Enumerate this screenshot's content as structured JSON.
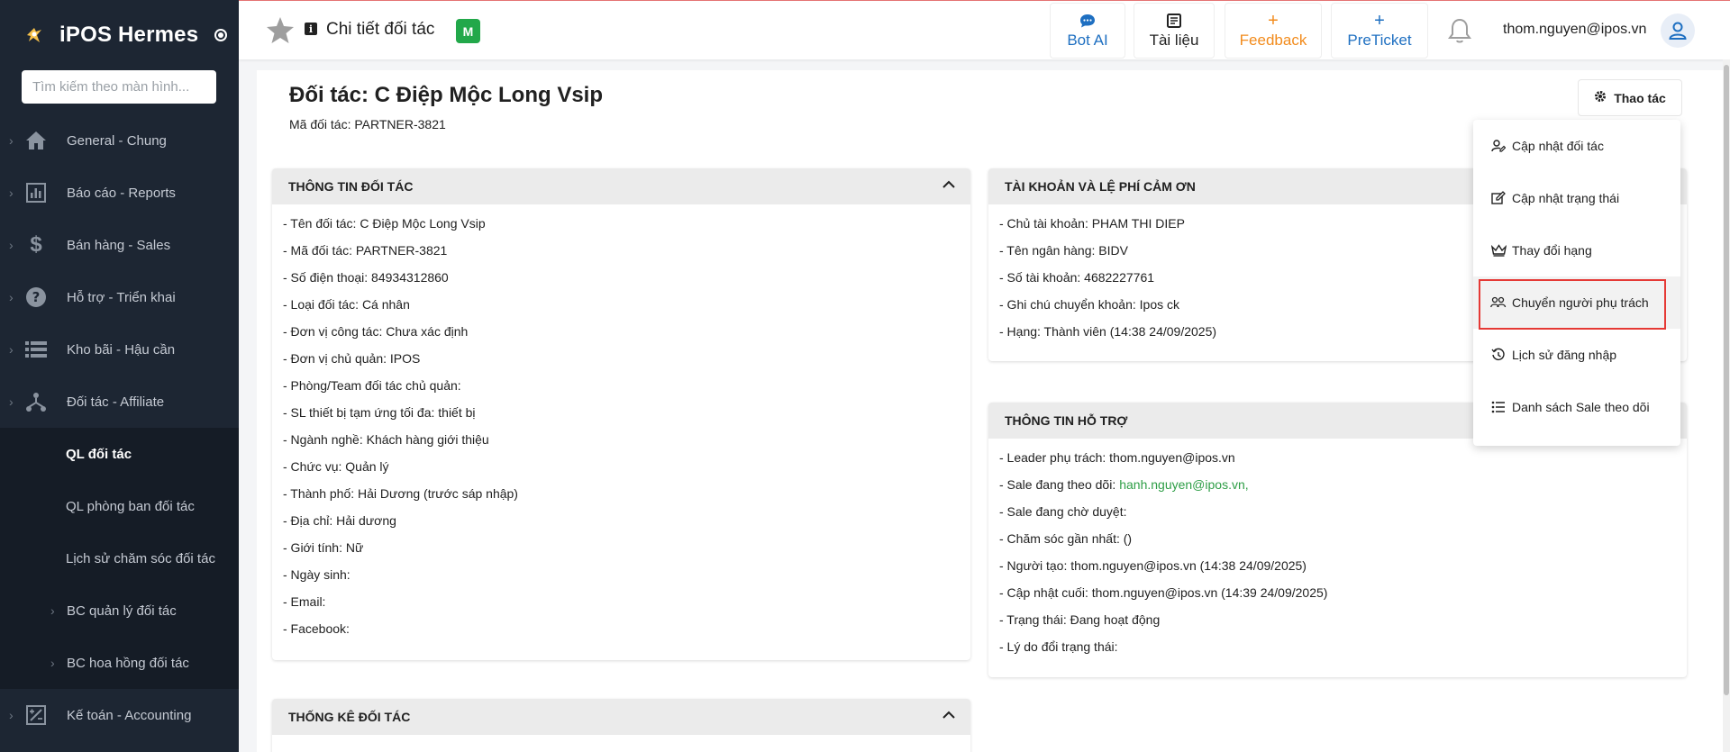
{
  "app": {
    "name": "iPOS Hermes",
    "search_placeholder": "Tìm kiếm theo màn hình..."
  },
  "sidebar": {
    "items": [
      {
        "label": "General - Chung",
        "icon": "home-icon"
      },
      {
        "label": "Báo cáo - Reports",
        "icon": "report-chart-icon"
      },
      {
        "label": "Bán hàng - Sales",
        "icon": "dollar-icon"
      },
      {
        "label": "Hỗ trợ - Triển khai",
        "icon": "help-circle-icon"
      },
      {
        "label": "Kho bãi - Hậu cần",
        "icon": "list-icon"
      },
      {
        "label": "Đối tác - Affiliate",
        "icon": "network-icon"
      }
    ],
    "sub_items": [
      {
        "label": "QL đối tác",
        "active": true
      },
      {
        "label": "QL phòng ban đối tác"
      },
      {
        "label": "Lịch sử chăm sóc đối tác"
      },
      {
        "label": "BC quản lý đối tác"
      },
      {
        "label": "BC hoa hồng đối tác"
      }
    ],
    "after_items": [
      {
        "label": "Kế toán - Accounting",
        "icon": "accounting-icon"
      }
    ]
  },
  "header": {
    "title": "Chi tiết đối tác",
    "badge": "M",
    "buttons": {
      "bot_ai": "Bot AI",
      "docs": "Tài liệu",
      "feedback": "Feedback",
      "preticket": "PreTicket",
      "feedback_icon": "+",
      "preticket_icon": "+"
    },
    "user_email": "thom.nguyen@ipos.vn"
  },
  "page": {
    "title": "Đối tác: C Điệp Mộc Long Vsip",
    "subtitle": "Mã đối tác: PARTNER-3821",
    "action_label": "Thao tác"
  },
  "partner_info": {
    "heading": "THÔNG TIN ĐỐI TÁC",
    "rows": [
      "- Tên đối tác: C Điệp Mộc Long Vsip",
      "- Mã đối tác: PARTNER-3821",
      "- Số điện thoại: 84934312860",
      "- Loại đối tác: Cá nhân",
      "- Đơn vị công tác: Chưa xác định",
      "- Đơn vị chủ quản: IPOS",
      "- Phòng/Team đối tác chủ quản:",
      "- SL thiết bị tạm ứng tối đa: thiết bị",
      "- Ngành nghề: Khách hàng giới thiệu",
      "- Chức vụ: Quản lý",
      "- Thành phố: Hải Dương (trước sáp nhập)",
      "- Địa chỉ: Hải dương",
      "- Giới tính: Nữ",
      "- Ngày sinh:",
      "- Email:",
      "- Facebook:"
    ]
  },
  "account_info": {
    "heading": "TÀI KHOẢN VÀ LỆ PHÍ CẢM ƠN",
    "rows": [
      "- Chủ tài khoản: PHAM THI DIEP",
      "- Tên ngân hàng: BIDV",
      "- Số tài khoản: 4682227761",
      "- Ghi chú chuyển khoản: Ipos ck",
      "- Hạng: Thành viên (14:38 24/09/2025)"
    ]
  },
  "support_info": {
    "heading": "THÔNG TIN HỖ TRỢ",
    "rows": [
      {
        "label": "- Leader phụ trách: thom.nguyen@ipos.vn",
        "link": ""
      },
      {
        "label": "- Sale đang theo dõi:",
        "link": "hanh.nguyen@ipos.vn,"
      },
      {
        "label": "- Sale đang chờ duyệt:",
        "link": ""
      },
      {
        "label": "- Chăm sóc gần nhất: ()",
        "link": ""
      },
      {
        "label": "- Người tạo: thom.nguyen@ipos.vn (14:38 24/09/2025)",
        "link": ""
      },
      {
        "label": "- Cập nhật cuối: thom.nguyen@ipos.vn (14:39 24/09/2025)",
        "link": ""
      },
      {
        "label": "- Trạng thái: Đang hoạt động",
        "link": ""
      },
      {
        "label": "- Lý do đổi trạng thái:",
        "link": ""
      }
    ]
  },
  "stats": {
    "heading": "THỐNG KÊ ĐỐI TÁC"
  },
  "action_menu": {
    "items": [
      {
        "label": "Cập nhật đối tác",
        "icon": "user-edit-icon"
      },
      {
        "label": "Cập nhật trạng thái",
        "icon": "edit-square-icon"
      },
      {
        "label": "Thay đổi hạng",
        "icon": "crown-icon"
      },
      {
        "label": "Chuyển người phụ trách",
        "icon": "users-transfer-icon",
        "highlighted": true
      },
      {
        "label": "Lịch sử đăng nhập",
        "icon": "history-icon"
      },
      {
        "label": "Danh sách Sale theo dõi",
        "icon": "list-bullets-icon"
      }
    ]
  },
  "colors": {
    "sidebar_bg": "#1d2633",
    "accent_blue": "#1e6fc1",
    "feedback_orange": "#f28b1c",
    "badge_green": "#22a84a",
    "link_green": "#2e9e46",
    "highlight_red": "#e53935"
  }
}
